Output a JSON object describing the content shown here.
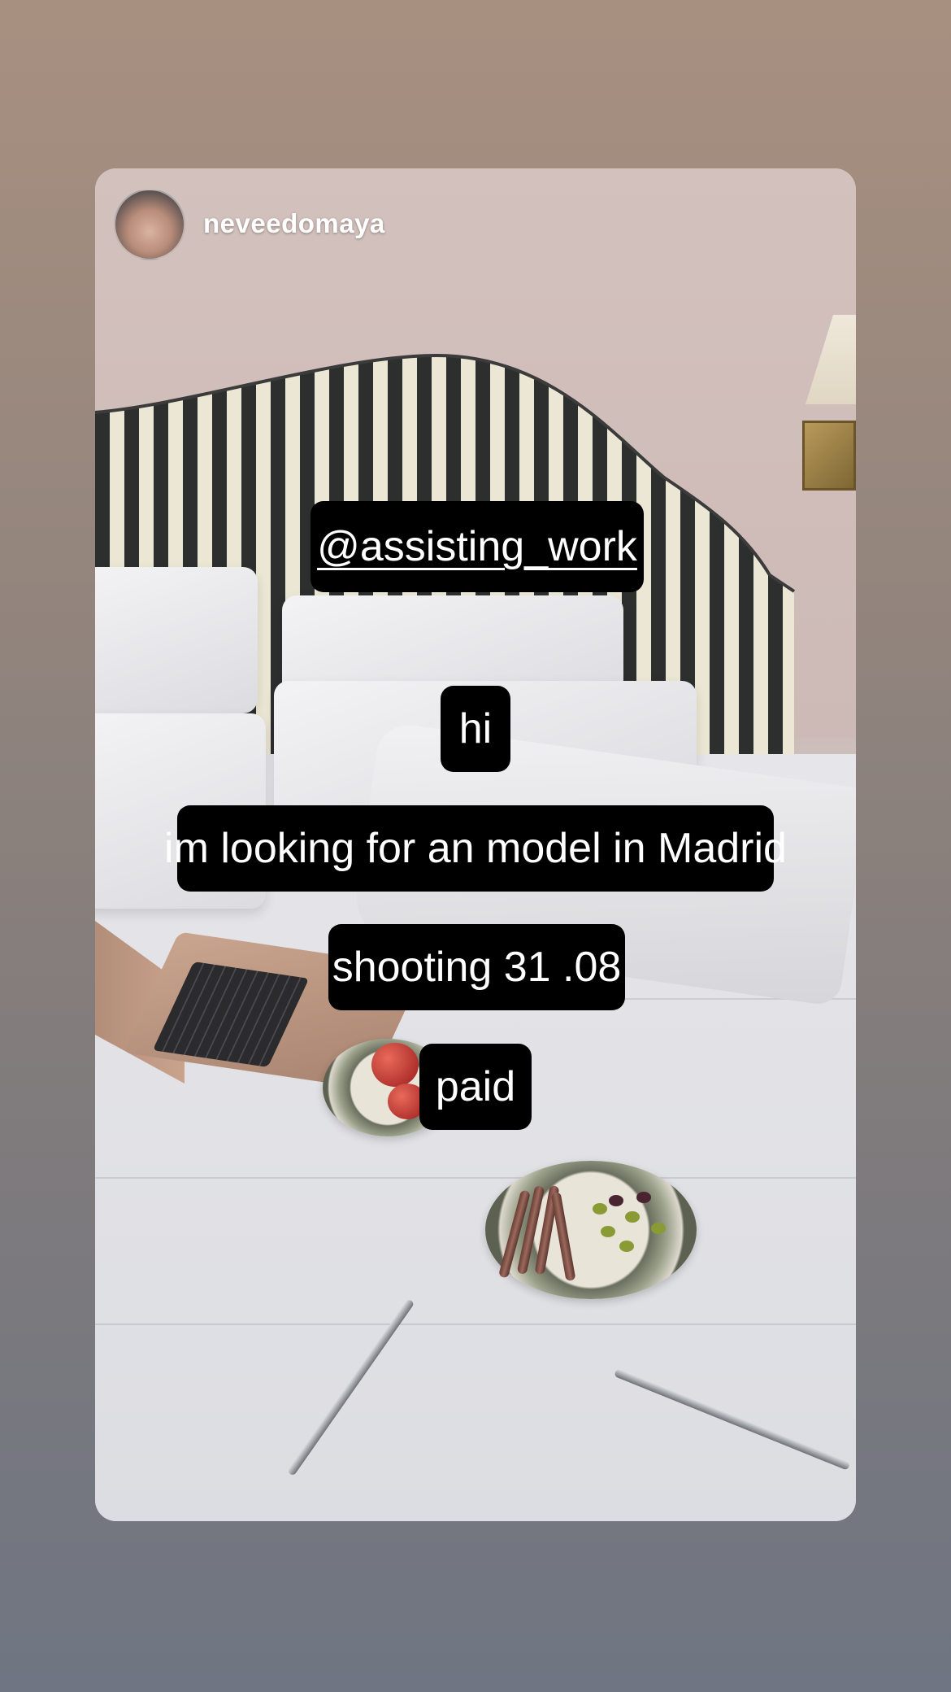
{
  "story": {
    "username": "neveedomaya",
    "mention": "@assisting_work",
    "captions": [
      "hi",
      "im looking for an model in Madrid",
      "shooting 31  .08",
      "paid"
    ]
  },
  "icons": {
    "avatar": "profile-photo",
    "scene": "hotel-bed-photo"
  },
  "colors": {
    "background_top": "#a89080",
    "background_bottom": "#6f7582",
    "sticker_bg": "#000000",
    "sticker_text": "#ffffff"
  }
}
